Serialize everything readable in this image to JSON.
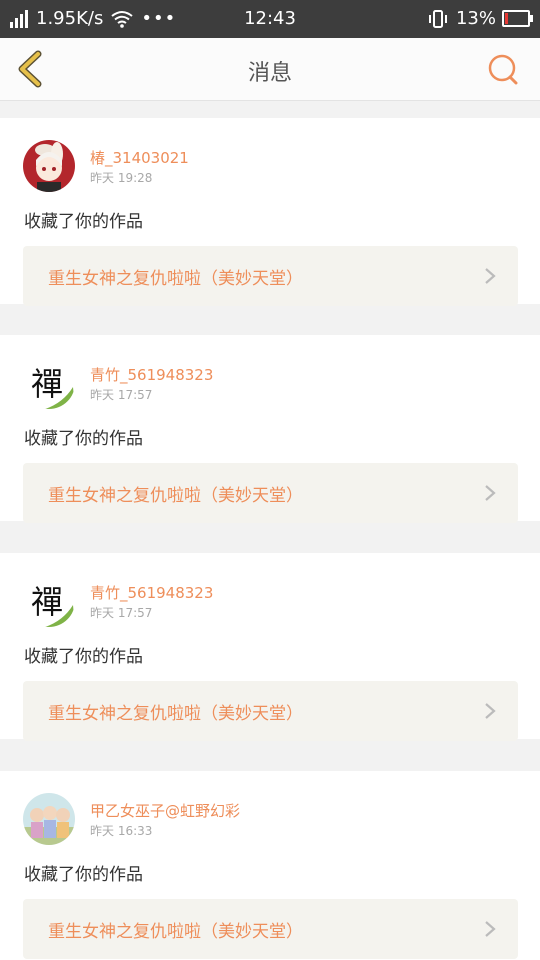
{
  "status_bar": {
    "speed": "1.95K/s",
    "more": "•••",
    "time": "12:43",
    "battery": "13%",
    "battery_level": 0.13,
    "signal_icon": "signal-icon",
    "wifi_icon": "wifi-icon",
    "vibrate_icon": "vibrate-icon"
  },
  "nav": {
    "title": "消息",
    "back_icon": "back-arrow-icon",
    "search_icon": "search-icon"
  },
  "colors": {
    "accent": "#ee8e5a",
    "back_arrow": "#e6c04a",
    "status_bg": "#3d3d3d",
    "card_bg": "#ffffff",
    "work_box_bg": "#f4f3ee"
  },
  "messages": [
    {
      "username": "椿_31403021",
      "time": "昨天 19:28",
      "action": "收藏了你的作品",
      "work_title": "重生女神之复仇啦啦（美妙天堂）",
      "avatar": "anime-avatar"
    },
    {
      "username": "青竹_561948323",
      "time": "昨天 17:57",
      "action": "收藏了你的作品",
      "work_title": "重生女神之复仇啦啦（美妙天堂）",
      "avatar": "zen-avatar",
      "avatar_char": "禪"
    },
    {
      "username": "青竹_561948323",
      "time": "昨天 17:57",
      "action": "收藏了你的作品",
      "work_title": "重生女神之复仇啦啦（美妙天堂）",
      "avatar": "zen-avatar",
      "avatar_char": "禪"
    },
    {
      "username": "甲乙女巫子@虹野幻彩",
      "time": "昨天 16:33",
      "action": "收藏了你的作品",
      "work_title": "重生女神之复仇啦啦（美妙天堂）",
      "avatar": "group-avatar"
    }
  ]
}
